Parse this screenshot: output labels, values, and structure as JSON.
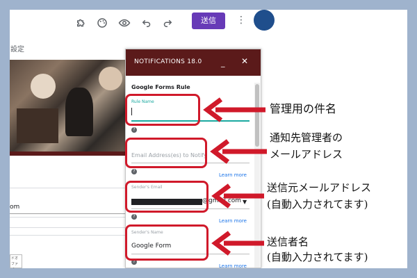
{
  "toolbar": {
    "send_label": "送信"
  },
  "settings_tab": "設定",
  "left_panel": {
    "text_om": "om",
    "small_icon_text": "ドオ ファイ"
  },
  "panel": {
    "title": "NOTIFICATIONS 18.0",
    "minimize": "_",
    "close": "✕",
    "rule_heading": "Google Forms Rule",
    "rule_name_label": "Rule Name",
    "email_placeholder": "Email Address(es) to Notify",
    "learn_more": "Learn more",
    "sender_email_label": "Sender's Email",
    "sender_email_value": "@gmail.com",
    "sender_name_label": "Sender's Name",
    "sender_name_value": "Google Form",
    "help_glyph": "?"
  },
  "annotations": {
    "rule_name": "管理用の件名",
    "notify_line1": "通知先管理者の",
    "notify_line2": "メールアドレス",
    "sender_email_line1": "送信元メールアドレス",
    "sender_email_line2": "(自動入力されてます)",
    "sender_name_line1": "送信者名",
    "sender_name_line2": "(自動入力されてます)"
  },
  "colors": {
    "accent_purple": "#673ab7",
    "panel_header": "#5b1a1a",
    "highlight_red": "#d0192a",
    "frame_blue": "#9fb3cd",
    "avatar": "#1f4e8c",
    "teal": "#1aa9a0"
  },
  "icons": [
    "puzzle-icon",
    "palette-icon",
    "eye-icon",
    "undo-icon",
    "redo-icon",
    "more-vert-icon"
  ]
}
